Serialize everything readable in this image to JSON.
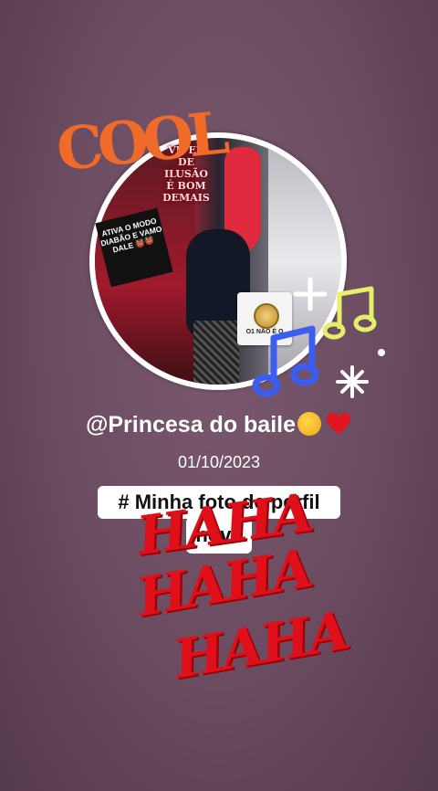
{
  "profile": {
    "username": "@Princesa do baile",
    "date": "01/10/2023",
    "hashtag_line1": "# Minha foto de perfil",
    "hashtag_line2": "nova"
  },
  "photo": {
    "overlay_text": "VIVER DE ILUSÃO É BOM DEMAIS",
    "sticker_text": "ATIVA O MODO DIABÃO E VAMO DALE 👹👹",
    "badge_text": "O1 NÃO É O"
  },
  "stickers": {
    "cool": "COOL",
    "haha_lines": [
      "HAHA",
      "HAHA",
      "HAHA"
    ]
  },
  "colors": {
    "background": "#6a4b60",
    "haha_red": "#e0101a",
    "cool_orange": "#f06a2a",
    "note_blue": "#3b5ef0",
    "note_yellow": "#e4f06a"
  },
  "icons": [
    "party-face-emoji",
    "red-heart-emoji",
    "music-note-icon",
    "sparkle-icon",
    "plus-icon"
  ]
}
